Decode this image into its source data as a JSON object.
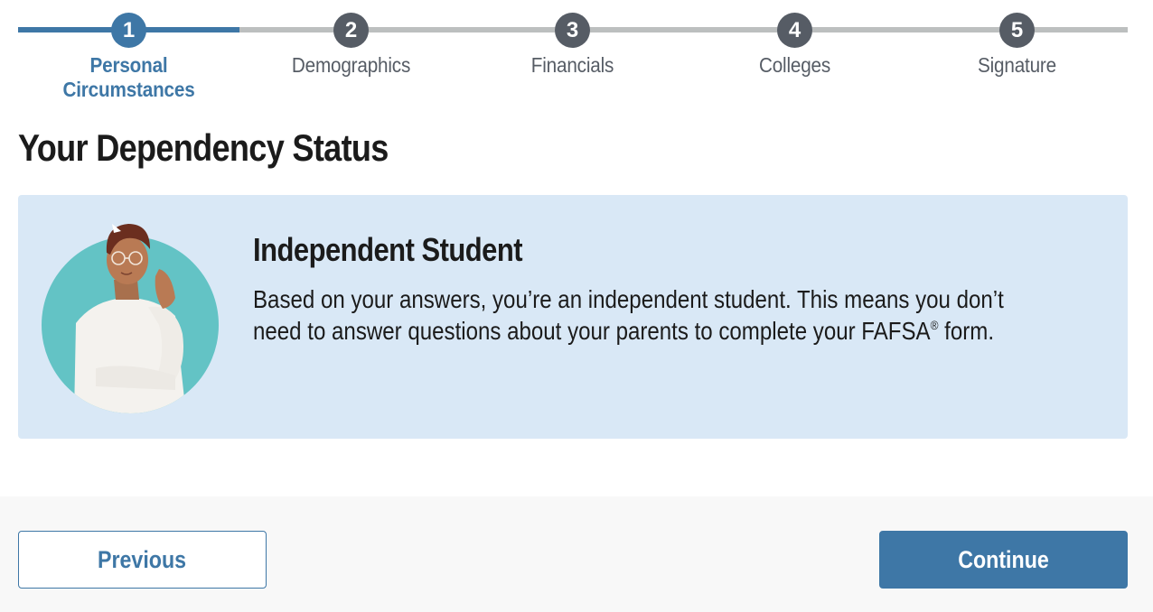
{
  "stepper": {
    "steps": [
      {
        "number": "1",
        "label": "Personal Circumstances",
        "state": "active"
      },
      {
        "number": "2",
        "label": "Demographics",
        "state": "upcoming"
      },
      {
        "number": "3",
        "label": "Financials",
        "state": "upcoming"
      },
      {
        "number": "4",
        "label": "Colleges",
        "state": "upcoming"
      },
      {
        "number": "5",
        "label": "Signature",
        "state": "upcoming"
      }
    ]
  },
  "page": {
    "title": "Your Dependency Status"
  },
  "card": {
    "avatar_icon": "student-thinking-illustration",
    "heading": "Independent Student",
    "body_pre": "Based on your answers, you’re an independent student. This means you don’t need to answer questions about your parents to complete your FAFSA",
    "body_mark": "®",
    "body_post": " form."
  },
  "footer": {
    "previous_label": "Previous",
    "continue_label": "Continue"
  },
  "colors": {
    "primary": "#3e77a6",
    "step_inactive": "#565c65",
    "track": "#bcbfbf",
    "card_bg": "#d9e8f6",
    "footer_bg": "#f8f8f8"
  }
}
